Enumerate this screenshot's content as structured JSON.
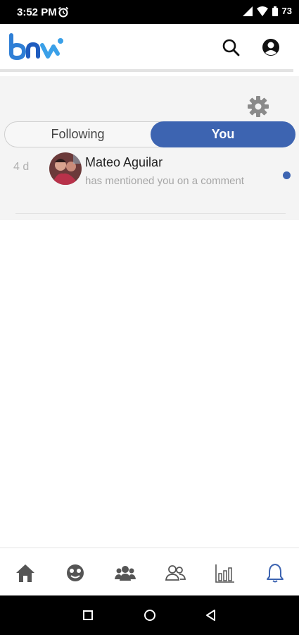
{
  "status_bar": {
    "time": "3:52 PM",
    "battery": "73"
  },
  "tabs": {
    "following": "Following",
    "you": "You"
  },
  "notifications": [
    {
      "age": "4 d",
      "name": "Mateo Aguilar",
      "message": "has mentioned you on a comment",
      "unread": true
    }
  ],
  "colors": {
    "accent": "#3d64b1",
    "logo_blue": "#2f7fd6",
    "status_bar": "#000000"
  },
  "icons": {
    "header": [
      "logo-icon",
      "search-icon",
      "account-icon"
    ],
    "settings": "gear-icon",
    "bottom_nav": [
      "home-icon",
      "feelings-icon",
      "groups-icon",
      "friends-icon",
      "stats-icon",
      "bell-icon"
    ],
    "system": [
      "recents-square-icon",
      "home-circle-icon",
      "back-triangle-icon"
    ]
  }
}
